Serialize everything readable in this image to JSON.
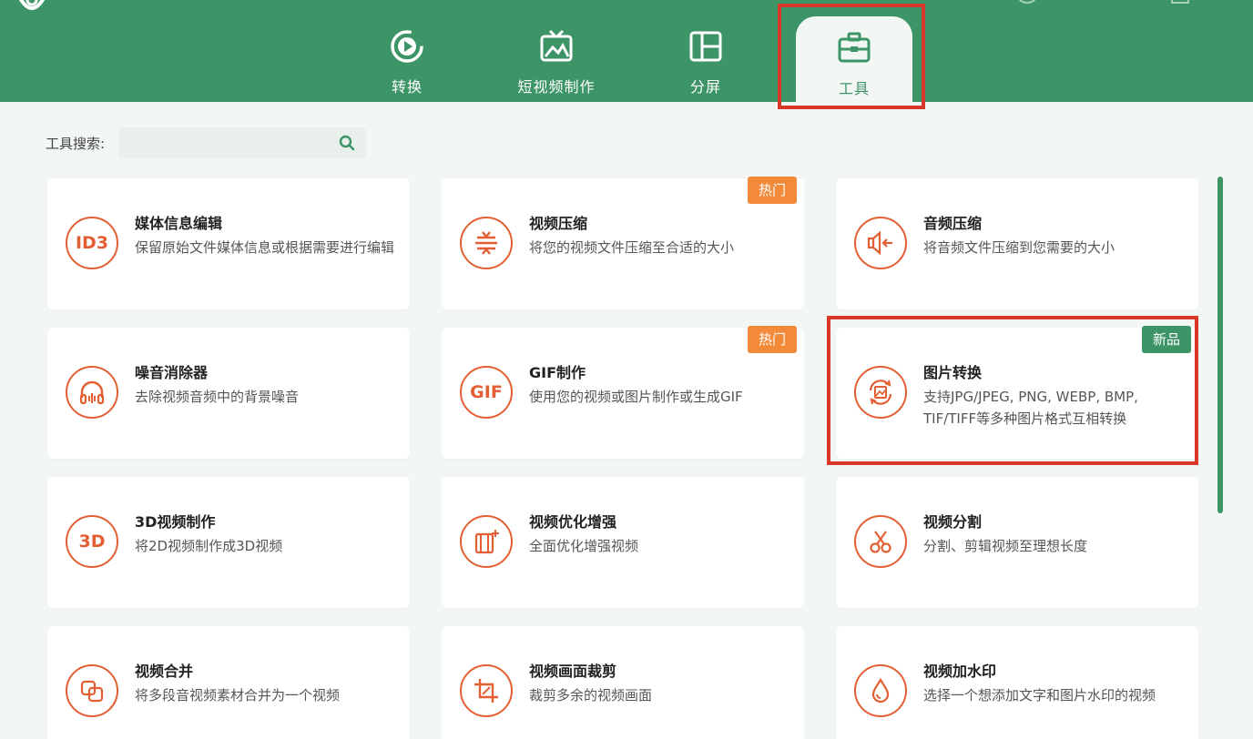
{
  "nav": {
    "tabs": [
      {
        "label": "转换",
        "icon": "convert-icon"
      },
      {
        "label": "短视频制作",
        "icon": "short-video-icon"
      },
      {
        "label": "分屏",
        "icon": "split-screen-icon"
      },
      {
        "label": "工具",
        "icon": "toolbox-icon",
        "active": true
      }
    ]
  },
  "search": {
    "label": "工具搜索:",
    "placeholder": "",
    "value": ""
  },
  "tools": [
    {
      "title": "媒体信息编辑",
      "desc": "保留原始文件媒体信息或根据需要进行编辑",
      "icon": "ID3"
    },
    {
      "title": "视频压缩",
      "desc": "将您的视频文件压缩至合适的大小",
      "icon": "compress-icon",
      "badge": "热门"
    },
    {
      "title": "音频压缩",
      "desc": "将音频文件压缩到您需要的大小",
      "icon": "audio-compress-icon"
    },
    {
      "title": "噪音消除器",
      "desc": "去除视频音频中的背景噪音",
      "icon": "headphone-icon"
    },
    {
      "title": "GIF制作",
      "desc": "使用您的视频或图片制作或生成GIF",
      "icon": "GIF",
      "badge": "热门"
    },
    {
      "title": "图片转换",
      "desc": "支持JPG/JPEG, PNG, WEBP, BMP, TIF/TIFF等多种图片格式互相转换",
      "icon": "image-convert-icon",
      "badge": "新品"
    },
    {
      "title": "3D视频制作",
      "desc": "将2D视频制作成3D视频",
      "icon": "3D"
    },
    {
      "title": "视频优化增强",
      "desc": "全面优化增强视频",
      "icon": "enhance-icon"
    },
    {
      "title": "视频分割",
      "desc": "分割、剪辑视频至理想长度",
      "icon": "scissors-icon"
    },
    {
      "title": "视频合并",
      "desc": "将多段音视频素材合并为一个视频",
      "icon": "merge-icon"
    },
    {
      "title": "视频画面裁剪",
      "desc": "裁剪多余的视频画面",
      "icon": "crop-icon"
    },
    {
      "title": "视频加水印",
      "desc": "选择一个想添加文字和图片水印的视频",
      "icon": "watermark-icon"
    }
  ],
  "colors": {
    "brand": "#3d9467",
    "accent": "#e35f33",
    "hot": "#f28a3a",
    "highlight": "#d9372a"
  }
}
